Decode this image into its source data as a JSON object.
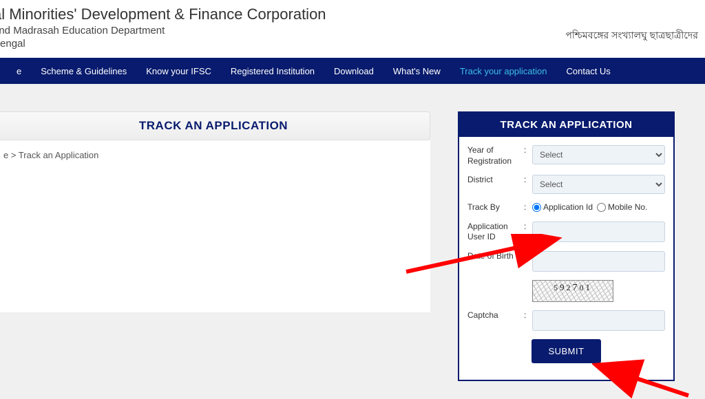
{
  "header": {
    "title": "al Minorities' Development & Finance Corporation",
    "sub1": " and Madrasah Education Department",
    "sub2": "Bengal",
    "bengali": "পশ্চিমবঙ্গের সংখ্যালঘু ছাত্রছাত্রীদের "
  },
  "nav": {
    "items": [
      "e",
      "Scheme & Guidelines",
      "Know your IFSC",
      "Registered Institution",
      "Download",
      "What's New",
      "Track your application",
      "Contact Us"
    ],
    "active_index": 6
  },
  "left": {
    "title": "TRACK AN APPLICATION",
    "breadcrumb": "e > Track an Application"
  },
  "form": {
    "title": "TRACK AN APPLICATION",
    "year_label": "Year of Registration",
    "year_value": "Select",
    "district_label": "District",
    "district_value": "Select",
    "trackby_label": "Track By",
    "trackby_option1": "Application Id",
    "trackby_option2": "Mobile No.",
    "appid_label": "Application User ID",
    "dob_label": "Date of Birth",
    "captcha_label": "Captcha",
    "captcha_text": "592701",
    "submit": "SUBMIT"
  }
}
